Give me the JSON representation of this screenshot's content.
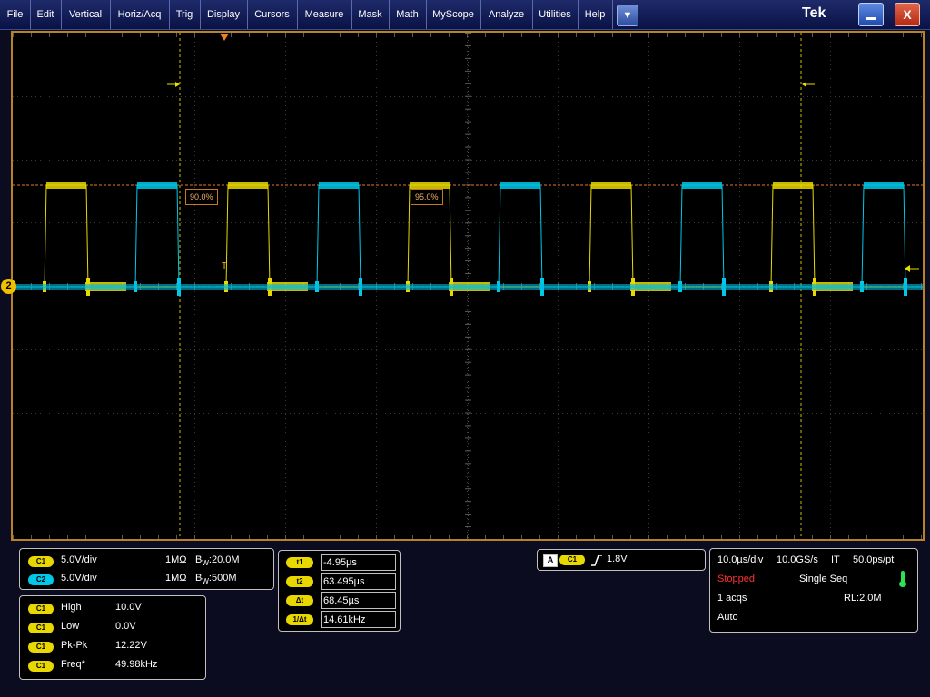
{
  "menubar": {
    "items": [
      {
        "label": "File"
      },
      {
        "label": "Edit"
      },
      {
        "label": "Vertical"
      },
      {
        "label": "Horiz/Acq"
      },
      {
        "label": "Trig"
      },
      {
        "label": "Display"
      },
      {
        "label": "Cursors"
      },
      {
        "label": "Measure"
      },
      {
        "label": "Mask"
      },
      {
        "label": "Math"
      },
      {
        "label": "MyScope"
      },
      {
        "label": "Analyze"
      },
      {
        "label": "Utilities"
      },
      {
        "label": "Help"
      }
    ],
    "dropdown_icon": "▼",
    "brand": "Tek",
    "minimize_icon": "minimize-icon",
    "close_label": "X"
  },
  "colors": {
    "ch1": "#e8d800",
    "ch2": "#00c8e8",
    "accent": "#b78326",
    "stopped": "#ff3030"
  },
  "scope": {
    "ref_left": "90.0%",
    "ref_right": "95.0%",
    "trigger_mark": "T",
    "ch2_marker": "2"
  },
  "channels": [
    {
      "badge": "C1",
      "scale": "5.0V/div",
      "coupling": "1MΩ",
      "bw_prefix": "B",
      "bw_sub": "W",
      "bw_value": ":20.0M"
    },
    {
      "badge": "C2",
      "scale": "5.0V/div",
      "coupling": "1MΩ",
      "bw_prefix": "B",
      "bw_sub": "W",
      "bw_value": ":500M"
    }
  ],
  "measurements": [
    {
      "badge": "C1",
      "name": "High",
      "value": "10.0V"
    },
    {
      "badge": "C1",
      "name": "Low",
      "value": "0.0V"
    },
    {
      "badge": "C1",
      "name": "Pk-Pk",
      "value": "12.22V"
    },
    {
      "badge": "C1",
      "name": "Freq*",
      "value": "49.98kHz"
    }
  ],
  "cursors": [
    {
      "label": "t1",
      "value": "-4.95µs"
    },
    {
      "label": "t2",
      "value": "63.495µs"
    },
    {
      "label": "Δt",
      "value": "68.45µs"
    },
    {
      "label": "1/Δt",
      "value": "14.61kHz"
    }
  ],
  "trigger": {
    "source_tag": "A",
    "source": "C1",
    "slope_icon": "rising-edge-icon",
    "level": "1.8V"
  },
  "acquisition": {
    "timebase": "10.0µs/div",
    "sample_rate": "10.0GS/s",
    "mode_flag": "IT",
    "resolution": "50.0ps/pt",
    "state": "Stopped",
    "seq": "Single Seq",
    "acqs": "1 acqs",
    "record_length": "RL:2.0M",
    "trigger_mode": "Auto"
  }
}
